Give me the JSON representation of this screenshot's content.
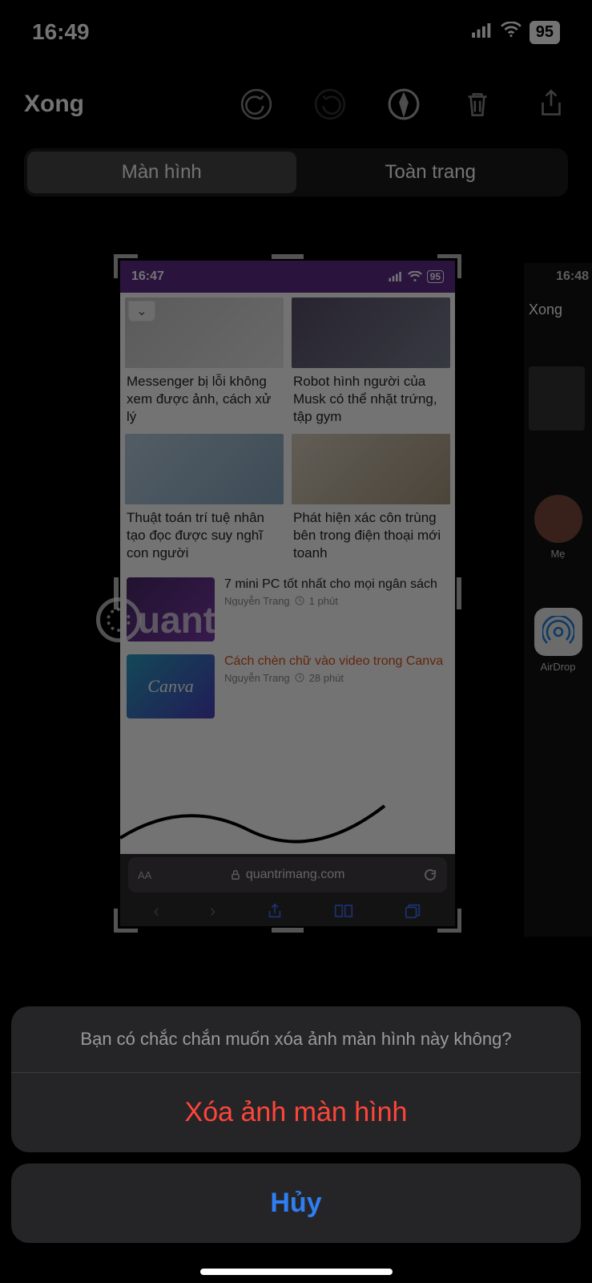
{
  "status": {
    "time": "16:49",
    "battery": "95"
  },
  "toolbar": {
    "done": "Xong"
  },
  "segmented": {
    "screen": "Màn hình",
    "fullpage": "Toàn trang"
  },
  "inner": {
    "time": "16:47",
    "battery": "95",
    "cards": [
      "Messenger bị lỗi không xem được ảnh, cách xử lý",
      "Robot hình người của Musk có thể nhặt trứng, tập gym",
      "Thuật toán trí tuệ nhân tạo đọc được suy nghĩ con người",
      "Phát hiện xác côn trùng bên trong điện thoại mới toanh"
    ],
    "list": [
      {
        "title": "7 mini PC tốt nhất cho mọi ngân sách",
        "author": "Nguyễn Trang",
        "ago": "1 phút",
        "thumb_label": ""
      },
      {
        "title": "Cách chèn chữ vào video trong Canva",
        "author": "Nguyễn Trang",
        "ago": "28 phút",
        "thumb_label": "Canva"
      }
    ],
    "url": "quantrimang.com",
    "aa": "AA"
  },
  "peek": {
    "time": "16:48",
    "done": "Xong",
    "contact": "Mẹ",
    "airdrop": "AirDrop"
  },
  "watermark": "uantrimang",
  "sheet": {
    "message": "Bạn có chắc chắn muốn xóa ảnh màn hình này không?",
    "delete": "Xóa ảnh màn hình",
    "cancel": "Hủy"
  }
}
